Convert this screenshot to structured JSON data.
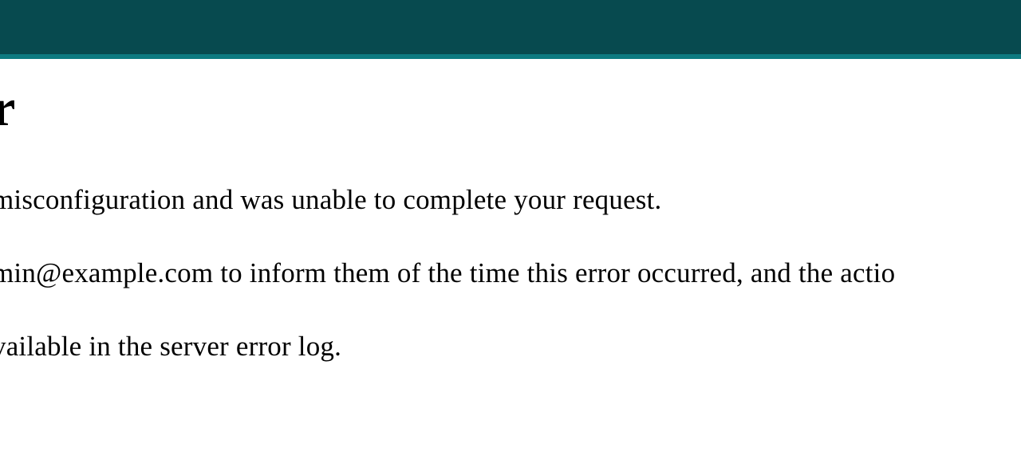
{
  "header": {
    "colors": {
      "bar": "#074a4f",
      "accent": "#0d7a80"
    }
  },
  "error": {
    "title_fragment": "r",
    "para1": "misconfiguration and was unable to complete your request.",
    "para2": "min@example.com to inform them of the time this error occurred, and the actio",
    "para3": "vailable in the server error log."
  }
}
